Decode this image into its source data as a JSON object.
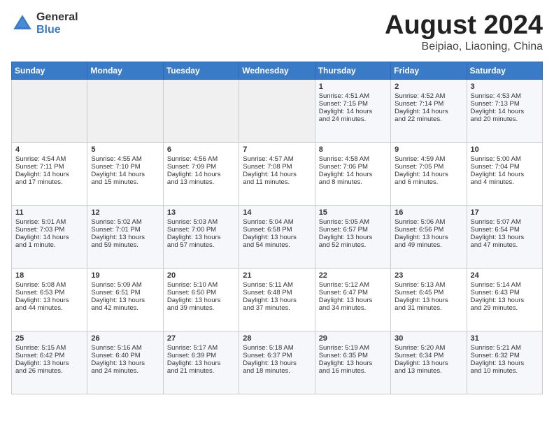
{
  "logo": {
    "general": "General",
    "blue": "Blue"
  },
  "title": "August 2024",
  "location": "Beipiao, Liaoning, China",
  "weekdays": [
    "Sunday",
    "Monday",
    "Tuesday",
    "Wednesday",
    "Thursday",
    "Friday",
    "Saturday"
  ],
  "weeks": [
    [
      {
        "day": "",
        "empty": true
      },
      {
        "day": "",
        "empty": true
      },
      {
        "day": "",
        "empty": true
      },
      {
        "day": "",
        "empty": true
      },
      {
        "day": "1",
        "line1": "Sunrise: 4:51 AM",
        "line2": "Sunset: 7:15 PM",
        "line3": "Daylight: 14 hours",
        "line4": "and 24 minutes."
      },
      {
        "day": "2",
        "line1": "Sunrise: 4:52 AM",
        "line2": "Sunset: 7:14 PM",
        "line3": "Daylight: 14 hours",
        "line4": "and 22 minutes."
      },
      {
        "day": "3",
        "line1": "Sunrise: 4:53 AM",
        "line2": "Sunset: 7:13 PM",
        "line3": "Daylight: 14 hours",
        "line4": "and 20 minutes."
      }
    ],
    [
      {
        "day": "4",
        "line1": "Sunrise: 4:54 AM",
        "line2": "Sunset: 7:11 PM",
        "line3": "Daylight: 14 hours",
        "line4": "and 17 minutes."
      },
      {
        "day": "5",
        "line1": "Sunrise: 4:55 AM",
        "line2": "Sunset: 7:10 PM",
        "line3": "Daylight: 14 hours",
        "line4": "and 15 minutes."
      },
      {
        "day": "6",
        "line1": "Sunrise: 4:56 AM",
        "line2": "Sunset: 7:09 PM",
        "line3": "Daylight: 14 hours",
        "line4": "and 13 minutes."
      },
      {
        "day": "7",
        "line1": "Sunrise: 4:57 AM",
        "line2": "Sunset: 7:08 PM",
        "line3": "Daylight: 14 hours",
        "line4": "and 11 minutes."
      },
      {
        "day": "8",
        "line1": "Sunrise: 4:58 AM",
        "line2": "Sunset: 7:06 PM",
        "line3": "Daylight: 14 hours",
        "line4": "and 8 minutes."
      },
      {
        "day": "9",
        "line1": "Sunrise: 4:59 AM",
        "line2": "Sunset: 7:05 PM",
        "line3": "Daylight: 14 hours",
        "line4": "and 6 minutes."
      },
      {
        "day": "10",
        "line1": "Sunrise: 5:00 AM",
        "line2": "Sunset: 7:04 PM",
        "line3": "Daylight: 14 hours",
        "line4": "and 4 minutes."
      }
    ],
    [
      {
        "day": "11",
        "line1": "Sunrise: 5:01 AM",
        "line2": "Sunset: 7:03 PM",
        "line3": "Daylight: 14 hours",
        "line4": "and 1 minute."
      },
      {
        "day": "12",
        "line1": "Sunrise: 5:02 AM",
        "line2": "Sunset: 7:01 PM",
        "line3": "Daylight: 13 hours",
        "line4": "and 59 minutes."
      },
      {
        "day": "13",
        "line1": "Sunrise: 5:03 AM",
        "line2": "Sunset: 7:00 PM",
        "line3": "Daylight: 13 hours",
        "line4": "and 57 minutes."
      },
      {
        "day": "14",
        "line1": "Sunrise: 5:04 AM",
        "line2": "Sunset: 6:58 PM",
        "line3": "Daylight: 13 hours",
        "line4": "and 54 minutes."
      },
      {
        "day": "15",
        "line1": "Sunrise: 5:05 AM",
        "line2": "Sunset: 6:57 PM",
        "line3": "Daylight: 13 hours",
        "line4": "and 52 minutes."
      },
      {
        "day": "16",
        "line1": "Sunrise: 5:06 AM",
        "line2": "Sunset: 6:56 PM",
        "line3": "Daylight: 13 hours",
        "line4": "and 49 minutes."
      },
      {
        "day": "17",
        "line1": "Sunrise: 5:07 AM",
        "line2": "Sunset: 6:54 PM",
        "line3": "Daylight: 13 hours",
        "line4": "and 47 minutes."
      }
    ],
    [
      {
        "day": "18",
        "line1": "Sunrise: 5:08 AM",
        "line2": "Sunset: 6:53 PM",
        "line3": "Daylight: 13 hours",
        "line4": "and 44 minutes."
      },
      {
        "day": "19",
        "line1": "Sunrise: 5:09 AM",
        "line2": "Sunset: 6:51 PM",
        "line3": "Daylight: 13 hours",
        "line4": "and 42 minutes."
      },
      {
        "day": "20",
        "line1": "Sunrise: 5:10 AM",
        "line2": "Sunset: 6:50 PM",
        "line3": "Daylight: 13 hours",
        "line4": "and 39 minutes."
      },
      {
        "day": "21",
        "line1": "Sunrise: 5:11 AM",
        "line2": "Sunset: 6:48 PM",
        "line3": "Daylight: 13 hours",
        "line4": "and 37 minutes."
      },
      {
        "day": "22",
        "line1": "Sunrise: 5:12 AM",
        "line2": "Sunset: 6:47 PM",
        "line3": "Daylight: 13 hours",
        "line4": "and 34 minutes."
      },
      {
        "day": "23",
        "line1": "Sunrise: 5:13 AM",
        "line2": "Sunset: 6:45 PM",
        "line3": "Daylight: 13 hours",
        "line4": "and 31 minutes."
      },
      {
        "day": "24",
        "line1": "Sunrise: 5:14 AM",
        "line2": "Sunset: 6:43 PM",
        "line3": "Daylight: 13 hours",
        "line4": "and 29 minutes."
      }
    ],
    [
      {
        "day": "25",
        "line1": "Sunrise: 5:15 AM",
        "line2": "Sunset: 6:42 PM",
        "line3": "Daylight: 13 hours",
        "line4": "and 26 minutes."
      },
      {
        "day": "26",
        "line1": "Sunrise: 5:16 AM",
        "line2": "Sunset: 6:40 PM",
        "line3": "Daylight: 13 hours",
        "line4": "and 24 minutes."
      },
      {
        "day": "27",
        "line1": "Sunrise: 5:17 AM",
        "line2": "Sunset: 6:39 PM",
        "line3": "Daylight: 13 hours",
        "line4": "and 21 minutes."
      },
      {
        "day": "28",
        "line1": "Sunrise: 5:18 AM",
        "line2": "Sunset: 6:37 PM",
        "line3": "Daylight: 13 hours",
        "line4": "and 18 minutes."
      },
      {
        "day": "29",
        "line1": "Sunrise: 5:19 AM",
        "line2": "Sunset: 6:35 PM",
        "line3": "Daylight: 13 hours",
        "line4": "and 16 minutes."
      },
      {
        "day": "30",
        "line1": "Sunrise: 5:20 AM",
        "line2": "Sunset: 6:34 PM",
        "line3": "Daylight: 13 hours",
        "line4": "and 13 minutes."
      },
      {
        "day": "31",
        "line1": "Sunrise: 5:21 AM",
        "line2": "Sunset: 6:32 PM",
        "line3": "Daylight: 13 hours",
        "line4": "and 10 minutes."
      }
    ]
  ]
}
